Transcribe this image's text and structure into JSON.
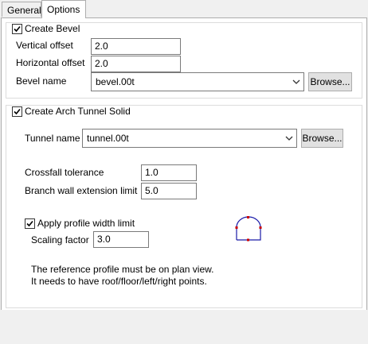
{
  "tabs": [
    {
      "label": "General"
    },
    {
      "label": "Options"
    }
  ],
  "bevel": {
    "checkbox_label": "Create Bevel",
    "checked": true,
    "vertical_offset_label": "Vertical offset",
    "vertical_offset_value": "2.0",
    "horizontal_offset_label": "Horizontal offset",
    "horizontal_offset_value": "2.0",
    "bevel_name_label": "Bevel name",
    "bevel_name_value": "bevel.00t",
    "browse_label": "Browse..."
  },
  "tunnel": {
    "checkbox_label": "Create Arch Tunnel Solid",
    "checked": true,
    "tunnel_name_label": "Tunnel name",
    "tunnel_name_value": "tunnel.00t",
    "browse_label": "Browse...",
    "crossfall_label": "Crossfall tolerance",
    "crossfall_value": "1.0",
    "branch_label": "Branch wall extension limit",
    "branch_value": "5.0",
    "apply_width_label": "Apply profile width limit",
    "apply_width_checked": true,
    "scaling_label": "Scaling factor",
    "scaling_value": "3.0",
    "note_line1": "The reference profile must be on plan view.",
    "note_line2": "It needs to have roof/floor/left/right points."
  },
  "colors": {
    "profile_line": "#1a1aa8",
    "profile_points": "#cc0000"
  }
}
